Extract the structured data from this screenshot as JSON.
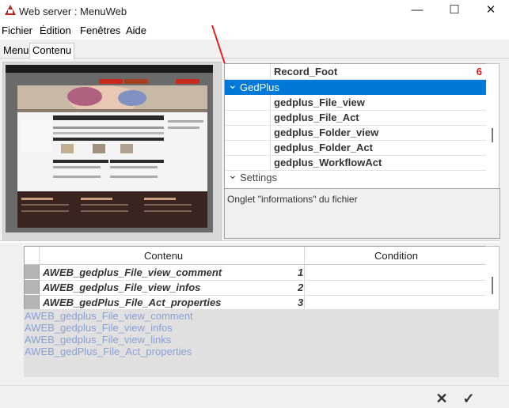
{
  "window": {
    "title": "Web server : MenuWeb",
    "min": "—",
    "max": "☐",
    "close": "✕"
  },
  "menubar": [
    "Fichier",
    "Édition",
    "Fenêtres",
    "Aide"
  ],
  "tabs": [
    "Menu",
    "Contenu"
  ],
  "tree": {
    "rows": [
      {
        "label": "Record_Foot",
        "num": "6",
        "selected": false,
        "group": false
      },
      {
        "label": "GedPlus",
        "num": "",
        "selected": true,
        "group": true,
        "chevron": "⌄"
      },
      {
        "label": "gedplus_File_view",
        "num": "",
        "selected": false,
        "group": false
      },
      {
        "label": "gedplus_File_Act",
        "num": "",
        "selected": false,
        "group": false
      },
      {
        "label": "gedplus_Folder_view",
        "num": "",
        "selected": false,
        "group": false
      },
      {
        "label": "gedplus_Folder_Act",
        "num": "",
        "selected": false,
        "group": false
      },
      {
        "label": "gedplus_WorkflowAct",
        "num": "",
        "selected": false,
        "group": false
      },
      {
        "label": "Settings",
        "num": "",
        "selected": false,
        "group": true,
        "chevron": "⌄"
      }
    ],
    "description": "Onglet \"informations\" du fichier"
  },
  "table": {
    "headers": [
      "Contenu",
      "Condition"
    ],
    "rows": [
      {
        "name": "AWEB_gedplus_File_view_comment",
        "num": "1"
      },
      {
        "name": "AWEB_gedplus_File_view_infos",
        "num": "2"
      },
      {
        "name": "AWEB_gedPlus_File_Act_properties",
        "num": "3"
      }
    ]
  },
  "list": [
    "AWEB_gedplus_File_view_comment",
    "AWEB_gedplus_File_view_infos",
    "AWEB_gedplus_File_view_links",
    "AWEB_gedPlus_File_Act_properties"
  ],
  "footer": {
    "cancel": "✕",
    "ok": "✓"
  },
  "colors": {
    "selection": "#0078d7",
    "accent_red": "#e01010",
    "list_text": "#8a9fd6"
  }
}
